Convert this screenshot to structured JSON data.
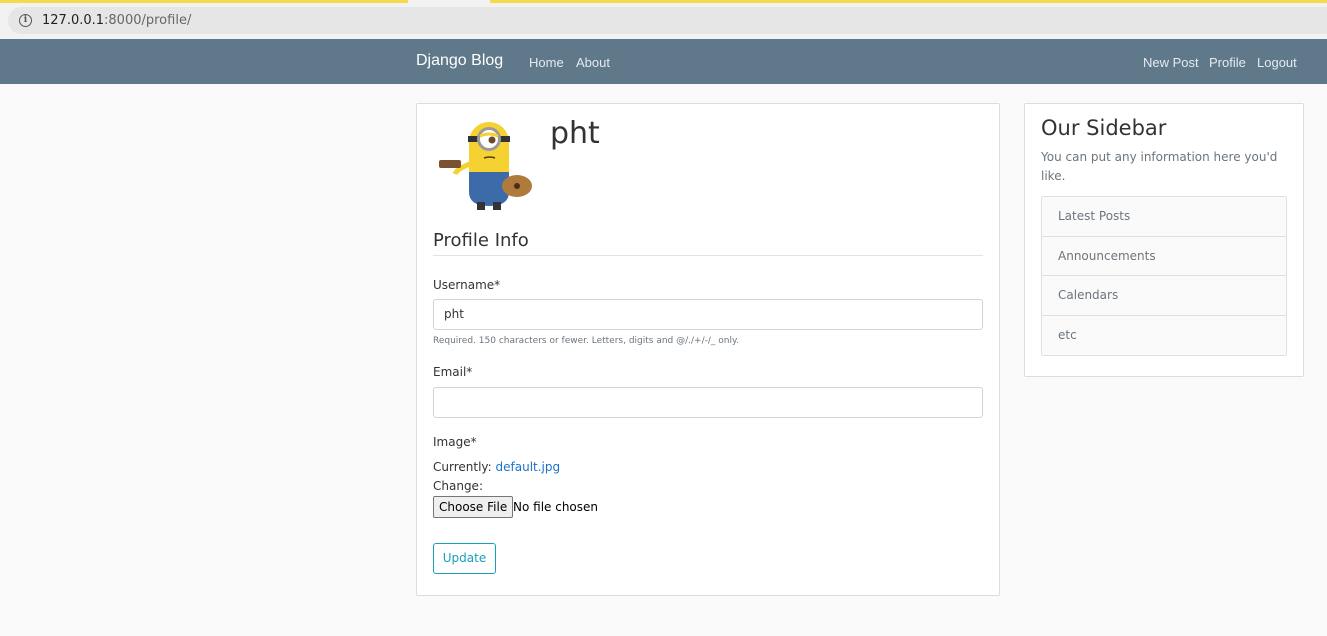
{
  "browser": {
    "url_host": "127.0.0.1",
    "url_rest": ":8000/profile/"
  },
  "navbar": {
    "brand": "Django Blog",
    "left_links": [
      "Home",
      "About"
    ],
    "right_links": [
      "New Post",
      "Profile",
      "Logout"
    ]
  },
  "profile": {
    "username_title": "pht",
    "avatar_icon": "minion-avatar"
  },
  "form": {
    "legend": "Profile Info",
    "username_label": "Username*",
    "username_value": "pht",
    "username_help": "Required. 150 characters or fewer. Letters, digits and @/./+/-/_ only.",
    "email_label": "Email*",
    "email_value": "",
    "image_label": "Image*",
    "currently_label": "Currently:",
    "currently_file": "default.jpg",
    "change_label": "Change:",
    "choose_file_button": "Choose File",
    "no_file_text": "No file chosen",
    "submit_label": "Update"
  },
  "sidebar": {
    "title": "Our Sidebar",
    "text": "You can put any information here you'd like.",
    "items": [
      "Latest Posts",
      "Announcements",
      "Calendars",
      "etc"
    ]
  },
  "colors": {
    "navbar_bg": "#5f788a",
    "accent": "#17a2b8",
    "link": "#1a73c7"
  }
}
